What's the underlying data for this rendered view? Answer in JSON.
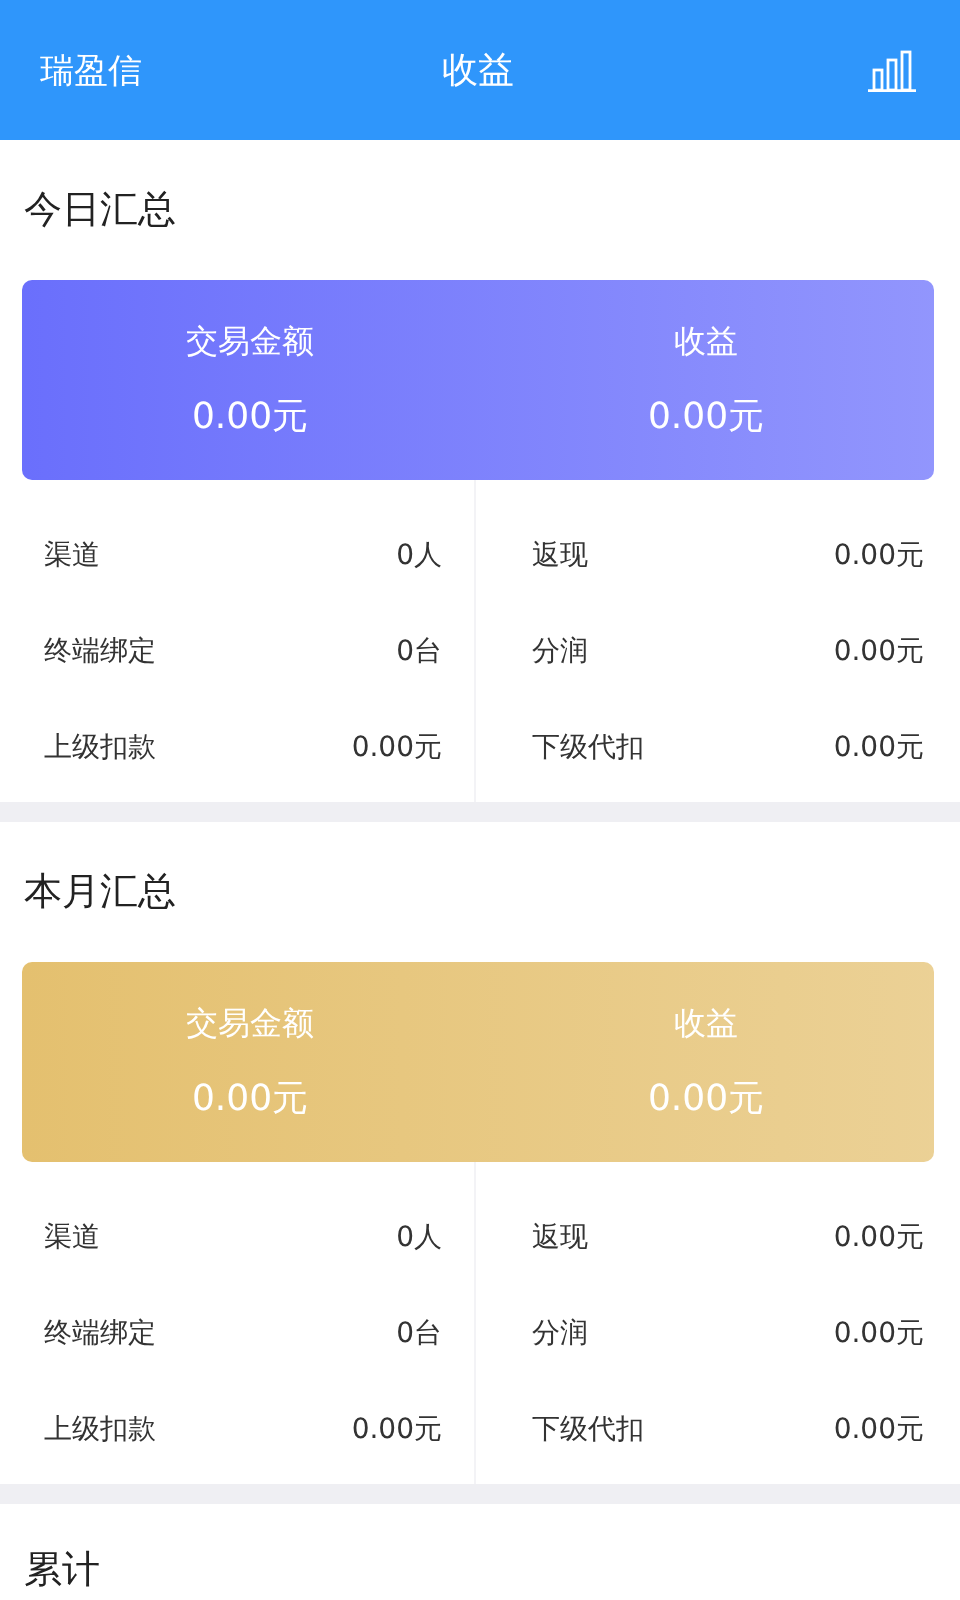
{
  "header": {
    "left": "瑞盈信",
    "title": "收益"
  },
  "sections": [
    {
      "title": "今日汇总",
      "color": "#6a6ffc",
      "card": [
        {
          "label": "交易金额",
          "value": "0.00元"
        },
        {
          "label": "收益",
          "value": "0.00元"
        }
      ],
      "stats": [
        {
          "label": "渠道",
          "value": "0人"
        },
        {
          "label": "返现",
          "value": "0.00元"
        },
        {
          "label": "终端绑定",
          "value": "0台"
        },
        {
          "label": "分润",
          "value": "0.00元"
        },
        {
          "label": "上级扣款",
          "value": "0.00元"
        },
        {
          "label": "下级代扣",
          "value": "0.00元"
        }
      ]
    },
    {
      "title": "本月汇总",
      "color": "#e4c06f",
      "card": [
        {
          "label": "交易金额",
          "value": "0.00元"
        },
        {
          "label": "收益",
          "value": "0.00元"
        }
      ],
      "stats": [
        {
          "label": "渠道",
          "value": "0人"
        },
        {
          "label": "返现",
          "value": "0.00元"
        },
        {
          "label": "终端绑定",
          "value": "0台"
        },
        {
          "label": "分润",
          "value": "0.00元"
        },
        {
          "label": "上级扣款",
          "value": "0.00元"
        },
        {
          "label": "下级代扣",
          "value": "0.00元"
        }
      ]
    },
    {
      "title": "累计"
    }
  ]
}
